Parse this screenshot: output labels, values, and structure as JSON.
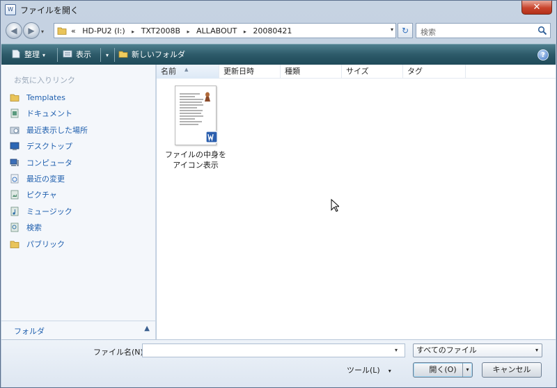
{
  "window": {
    "app_icon_text": "W",
    "title": "ファイルを開く",
    "close_glyph": "✕"
  },
  "address_bar": {
    "back_glyph": "◀",
    "forward_glyph": "▶",
    "overflow": "«",
    "crumbs": [
      "HD-PU2 (I:)",
      "TXT2008B",
      "ALLABOUT",
      "20080421"
    ],
    "separator": "▸",
    "dropdown_glyph": "▾",
    "refresh_glyph": "↻",
    "search_placeholder": "検索"
  },
  "toolbar": {
    "organize": "整理",
    "views": "表示",
    "new_folder": "新しいフォルダ",
    "arrow_glyph": "▾",
    "help_glyph": "?"
  },
  "nav_pane": {
    "favorites_heading": "お気に入りリンク",
    "items": [
      {
        "label": "Templates",
        "icon": "folder-icon"
      },
      {
        "label": "ドキュメント",
        "icon": "documents-icon"
      },
      {
        "label": "最近表示した場所",
        "icon": "recent-places-icon"
      },
      {
        "label": "デスクトップ",
        "icon": "desktop-icon"
      },
      {
        "label": "コンピュータ",
        "icon": "computer-icon"
      },
      {
        "label": "最近の変更",
        "icon": "recent-changes-icon"
      },
      {
        "label": "ピクチャ",
        "icon": "pictures-icon"
      },
      {
        "label": "ミュージック",
        "icon": "music-icon"
      },
      {
        "label": "検索",
        "icon": "search-folder-icon"
      },
      {
        "label": "パブリック",
        "icon": "public-folder-icon"
      }
    ],
    "folders_label": "フォルダ",
    "folders_toggle_glyph": "▲"
  },
  "file_list": {
    "columns": [
      "名前",
      "更新日時",
      "種類",
      "サイズ",
      "タグ"
    ],
    "sort_glyph": "▲",
    "files": [
      {
        "label_line1": "ファイルの中身を",
        "label_line2": "アイコン表示"
      }
    ]
  },
  "bottom": {
    "filename_label": "ファイル名(N):",
    "filename_value": "",
    "filetype_value": "すべてのファイル",
    "dropdown_glyph": "▾",
    "tools_label": "ツール(L)",
    "open_label": "開く(O)",
    "cancel_label": "キャンセル"
  },
  "colors": {
    "link_blue": "#1f5fae",
    "toolbar_teal": "#2d5a69",
    "close_red": "#c8442c"
  }
}
